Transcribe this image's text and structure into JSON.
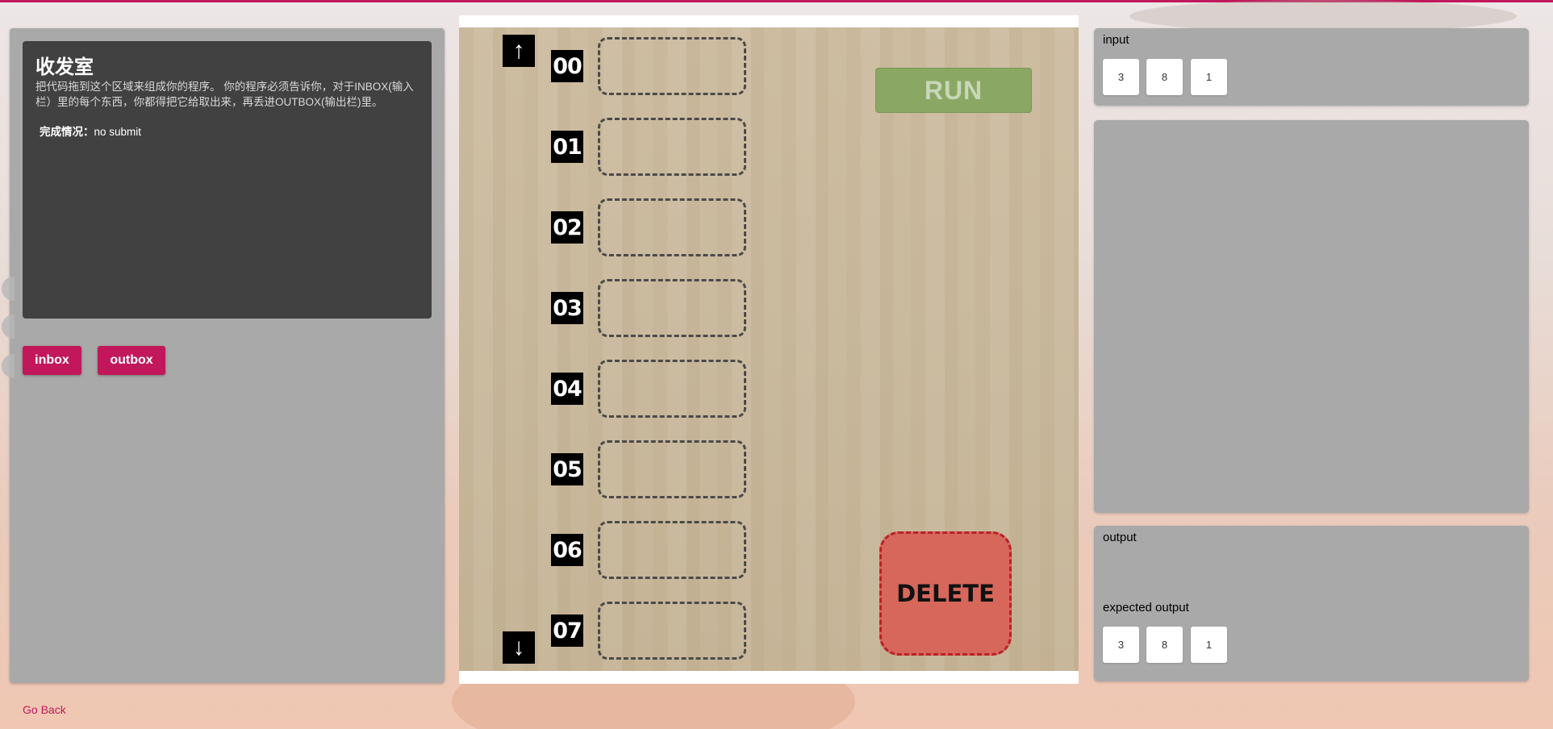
{
  "level": {
    "title": "收发室",
    "description": "把代码拖到这个区域来组成你的程序。 你的程序必须告诉你，对于INBOX(输入栏）里的每个东西，你都得把它给取出来，再丢进OUTBOX(输出栏)里。",
    "status_label": "完成情况：",
    "status_value": "no submit"
  },
  "commands": [
    {
      "label": "inbox"
    },
    {
      "label": "outbox"
    }
  ],
  "nav": {
    "go_back": "Go Back"
  },
  "program": {
    "up_arrow": "↑",
    "down_arrow": "↓",
    "lines": [
      "00",
      "01",
      "02",
      "03",
      "04",
      "05",
      "06",
      "07"
    ],
    "run_label": "RUN",
    "delete_label": "DELETE"
  },
  "input_panel": {
    "label": "input",
    "items": [
      "3",
      "8",
      "1"
    ]
  },
  "output_panel": {
    "label": "output",
    "items": [],
    "expected_label": "expected output",
    "expected_items": [
      "3",
      "8",
      "1"
    ]
  },
  "colors": {
    "accent": "#c2185b",
    "run_button": "#8aa864",
    "delete_zone": "#d7675a",
    "panel": "#a9a9a9",
    "card": "#414141"
  }
}
